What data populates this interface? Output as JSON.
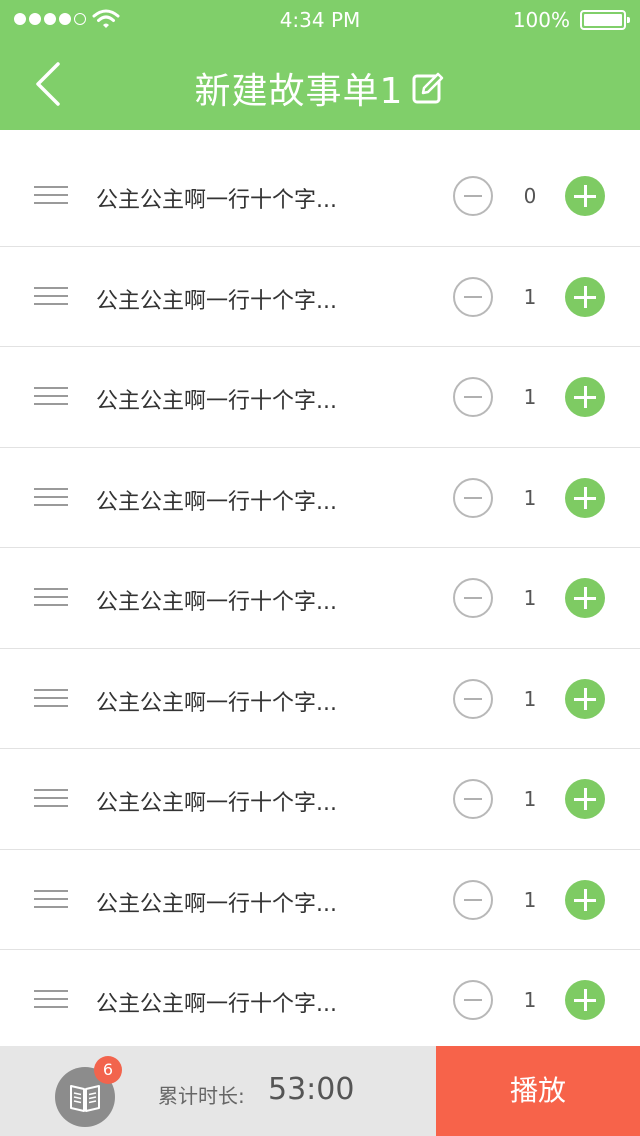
{
  "status_bar": {
    "time": "4:34 PM",
    "battery": "100%"
  },
  "nav": {
    "title": "新建故事单1"
  },
  "list": [
    {
      "title": "公主公主啊一行十个字...",
      "count": "0"
    },
    {
      "title": "公主公主啊一行十个字...",
      "count": "1"
    },
    {
      "title": "公主公主啊一行十个字...",
      "count": "1"
    },
    {
      "title": "公主公主啊一行十个字...",
      "count": "1"
    },
    {
      "title": "公主公主啊一行十个字...",
      "count": "1"
    },
    {
      "title": "公主公主啊一行十个字...",
      "count": "1"
    },
    {
      "title": "公主公主啊一行十个字...",
      "count": "1"
    },
    {
      "title": "公主公主啊一行十个字...",
      "count": "1"
    },
    {
      "title": "公主公主啊一行十个字...",
      "count": "1"
    }
  ],
  "footer": {
    "badge": "6",
    "duration_label": "累计时长:",
    "duration_value": "53:00",
    "play_label": "播放"
  },
  "icons": {
    "back": "chevron-left-icon",
    "edit": "edit-icon",
    "drag": "drag-handle-icon",
    "minus": "minus-circle-icon",
    "plus": "plus-circle-icon",
    "book": "book-icon"
  },
  "colors": {
    "header": "#80cf6a",
    "plus": "#7ecb63",
    "play": "#f7634a",
    "badge": "#f2644d"
  }
}
